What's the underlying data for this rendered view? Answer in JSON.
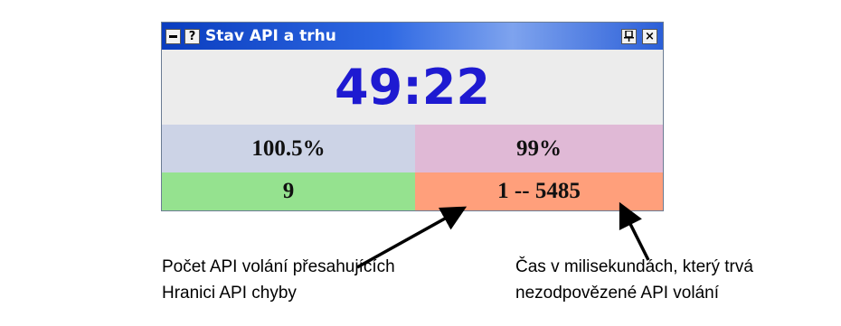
{
  "window": {
    "title": "Stav API a trhu",
    "buttons": {
      "menu_icon": "minimize-icon",
      "help_label": "?",
      "pin_label": "■",
      "close_label": "×"
    }
  },
  "clock": {
    "value": "49:22",
    "color": "#1e1ad1"
  },
  "stats": {
    "top_left": "100.5%",
    "top_right": "99%",
    "bottom_left": "9",
    "bottom_right": "1 -- 5485"
  },
  "colors": {
    "top_left_bg": "#ccd3e6",
    "top_right_bg": "#e0b9d6",
    "bottom_left_bg": "#95e28f",
    "bottom_right_bg": "#ff9f7b"
  },
  "annotations": {
    "left_line1": "Počet API volání přesahujících",
    "left_line2": "Hranici API chyby",
    "right_line1": "Čas v milisekundách, který trvá",
    "right_line2": "nezodpovězené API volání"
  }
}
